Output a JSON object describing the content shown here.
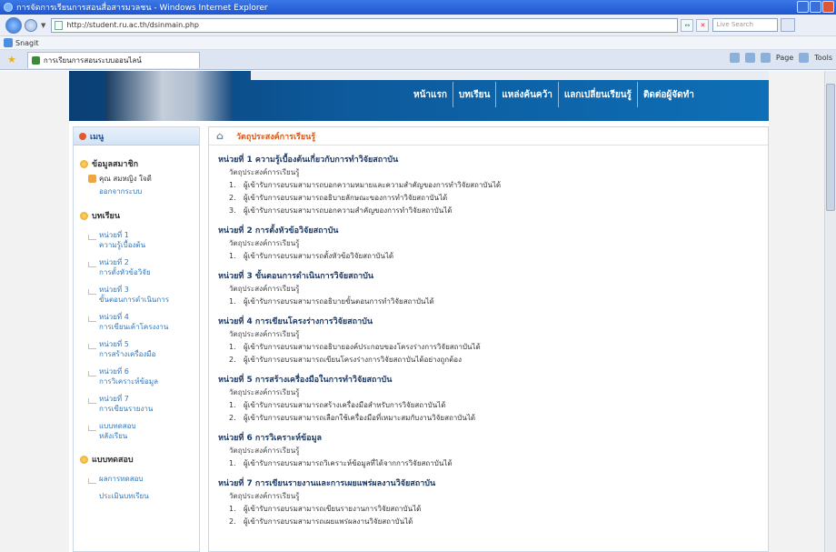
{
  "window": {
    "title": "การจัดการเรียนการสอนสื่อสารมวลชน - Windows Internet Explorer",
    "address": "http://student.ru.ac.th/dsinmain.php",
    "search_placeholder": "Live Search"
  },
  "links_bar": {
    "label": "Snagit"
  },
  "tab": {
    "label": "การเรียนการสอนระบบออนไลน์",
    "commands": [
      "Page",
      "Tools"
    ]
  },
  "site": {
    "nav": [
      "หน้าแรก",
      "บทเรียน",
      "แหล่งค้นคว้า",
      "แลกเปลี่ยนเรียนรู้",
      "ติดต่อผู้จัดทำ"
    ],
    "menu_title": "เมนู",
    "sections": {
      "member": "ข้อมูลสมาชิก",
      "lessons": "บทเรียน",
      "evaluation": "แบบทดสอบ"
    },
    "user": {
      "name": "คุณ สมหญิง ใจดี",
      "link": "ออกจากระบบ"
    },
    "lesson_links": [
      {
        "l1": "หน่วยที่ 1",
        "l2": "ความรู้เบื้องต้น"
      },
      {
        "l1": "หน่วยที่ 2",
        "l2": "การตั้งหัวข้อวิจัย"
      },
      {
        "l1": "หน่วยที่ 3",
        "l2": "ขั้นตอนการดำเนินการ"
      },
      {
        "l1": "หน่วยที่ 4",
        "l2": "การเขียนเค้าโครงงาน"
      },
      {
        "l1": "หน่วยที่ 5",
        "l2": "การสร้างเครื่องมือ"
      },
      {
        "l1": "หน่วยที่ 6",
        "l2": "การวิเคราะห์ข้อมูล"
      },
      {
        "l1": "หน่วยที่ 7",
        "l2": "การเขียนรายงาน"
      },
      {
        "l1": "แบบทดสอบ",
        "l2": "หลังเรียน"
      }
    ],
    "eval_links": [
      "ผลการทดสอบ",
      "ประเมินบทเรียน"
    ]
  },
  "main": {
    "breadcrumb": "วัตถุประสงค์การเรียนรู้",
    "units": [
      {
        "title": "หน่วยที่ 1  ความรู้เบื้องต้นเกี่ยวกับการทำวิจัยสถาบัน",
        "obj": "วัตถุประสงค์การเรียนรู้",
        "lines": [
          "ผู้เข้ารับการอบรมสามารถบอกความหมายและความสำคัญของการทำวิจัยสถาบันได้",
          "ผู้เข้ารับการอบรมสามารถอธิบายลักษณะของการทำวิจัยสถาบันได้",
          "ผู้เข้ารับการอบรมสามารถบอกความสำคัญของการทำวิจัยสถาบันได้"
        ]
      },
      {
        "title": "หน่วยที่ 2  การตั้งหัวข้อวิจัยสถาบัน",
        "obj": "วัตถุประสงค์การเรียนรู้",
        "lines": [
          "ผู้เข้ารับการอบรมสามารถตั้งหัวข้อวิจัยสถาบันได้"
        ]
      },
      {
        "title": "หน่วยที่ 3  ขั้นตอนการดำเนินการวิจัยสถาบัน",
        "obj": "วัตถุประสงค์การเรียนรู้",
        "lines": [
          "ผู้เข้ารับการอบรมสามารถอธิบายขั้นตอนการทำวิจัยสถาบันได้"
        ]
      },
      {
        "title": "หน่วยที่ 4  การเขียนโครงร่างการวิจัยสถาบัน",
        "obj": "วัตถุประสงค์การเรียนรู้",
        "lines": [
          "ผู้เข้ารับการอบรมสามารถอธิบายองค์ประกอบของโครงร่างการวิจัยสถาบันได้",
          "ผู้เข้ารับการอบรมสามารถเขียนโครงร่างการวิจัยสถาบันได้อย่างถูกต้อง"
        ]
      },
      {
        "title": "หน่วยที่ 5  การสร้างเครื่องมือในการทำวิจัยสถาบัน",
        "obj": "วัตถุประสงค์การเรียนรู้",
        "lines": [
          "ผู้เข้ารับการอบรมสามารถสร้างเครื่องมือสำหรับการวิจัยสถาบันได้",
          "ผู้เข้ารับการอบรมสามารถเลือกใช้เครื่องมือที่เหมาะสมกับงานวิจัยสถาบันได้"
        ]
      },
      {
        "title": "หน่วยที่ 6  การวิเคราะห์ข้อมูล",
        "obj": "วัตถุประสงค์การเรียนรู้",
        "lines": [
          "ผู้เข้ารับการอบรมสามารถวิเคราะห์ข้อมูลที่ได้จากการวิจัยสถาบันได้"
        ]
      },
      {
        "title": "หน่วยที่ 7  การเขียนรายงานและการเผยแพร่ผลงานวิจัยสถาบัน",
        "obj": "วัตถุประสงค์การเรียนรู้",
        "lines": [
          "ผู้เข้ารับการอบรมสามารถเขียนรายงานการวิจัยสถาบันได้",
          "ผู้เข้ารับการอบรมสามารถเผยแพร่ผลงานวิจัยสถาบันได้"
        ]
      }
    ]
  }
}
